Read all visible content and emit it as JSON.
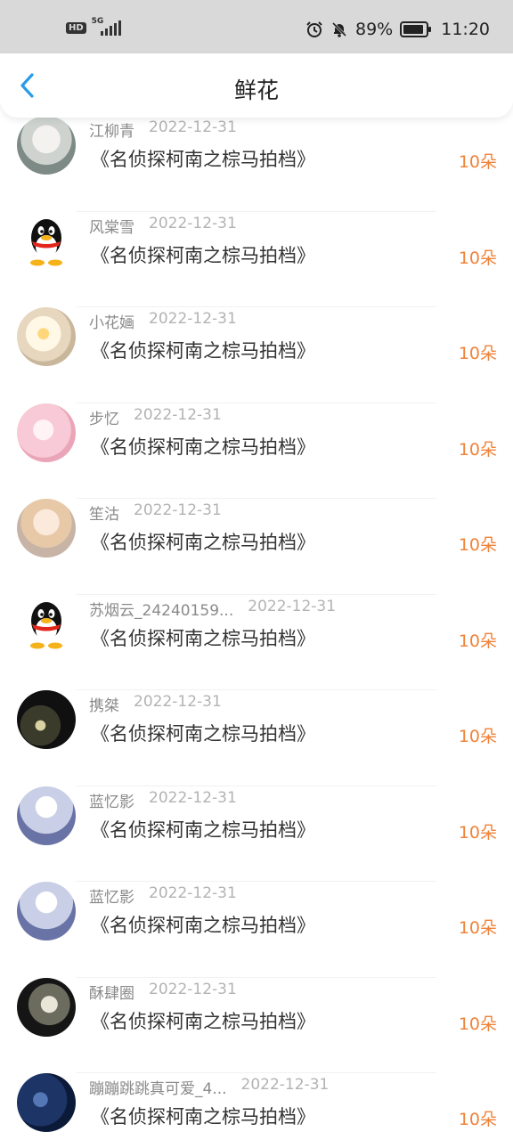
{
  "status_bar": {
    "hd": "HD",
    "network": "5G",
    "battery": "89%",
    "time": "11:20"
  },
  "header": {
    "title": "鲜花"
  },
  "items": [
    {
      "user": "江柳青",
      "date": "2022-12-31",
      "movie": "《名侦探柯南之棕马拍档》",
      "count": "10朵",
      "avatar": "fairy-avatar"
    },
    {
      "user": "风棠雪",
      "date": "2022-12-31",
      "movie": "《名侦探柯南之棕马拍档》",
      "count": "10朵",
      "avatar": "qq-penguin-avatar"
    },
    {
      "user": "小花婳",
      "date": "2022-12-31",
      "movie": "《名侦探柯南之棕马拍档》",
      "count": "10朵",
      "avatar": "flower-avatar"
    },
    {
      "user": "步忆",
      "date": "2022-12-31",
      "movie": "《名侦探柯南之棕马拍档》",
      "count": "10朵",
      "avatar": "pink-anime-avatar"
    },
    {
      "user": "笙沽",
      "date": "2022-12-31",
      "movie": "《名侦探柯南之棕马拍档》",
      "count": "10朵",
      "avatar": "anime-girl-avatar"
    },
    {
      "user": "苏烟云_24240159...",
      "date": "2022-12-31",
      "movie": "《名侦探柯南之棕马拍档》",
      "count": "10朵",
      "avatar": "qq-penguin-avatar"
    },
    {
      "user": "携桀",
      "date": "2022-12-31",
      "movie": "《名侦探柯南之棕马拍档》",
      "count": "10朵",
      "avatar": "dark-art-avatar"
    },
    {
      "user": "蓝忆影",
      "date": "2022-12-31",
      "movie": "《名侦探柯南之棕马拍档》",
      "count": "10朵",
      "avatar": "moon-avatar"
    },
    {
      "user": "蓝忆影",
      "date": "2022-12-31",
      "movie": "《名侦探柯南之棕马拍档》",
      "count": "10朵",
      "avatar": "moon-avatar"
    },
    {
      "user": "酥肆圈",
      "date": "2022-12-31",
      "movie": "《名侦探柯南之棕马拍档》",
      "count": "10朵",
      "avatar": "dark-moon-avatar"
    },
    {
      "user": "蹦蹦跳跳真可爱_4...",
      "date": "2022-12-31",
      "movie": "《名侦探柯南之棕马拍档》",
      "count": "10朵",
      "avatar": "night-sky-avatar"
    }
  ],
  "colors": {
    "accent_back": "#2a9bea",
    "count": "#f0833a"
  }
}
